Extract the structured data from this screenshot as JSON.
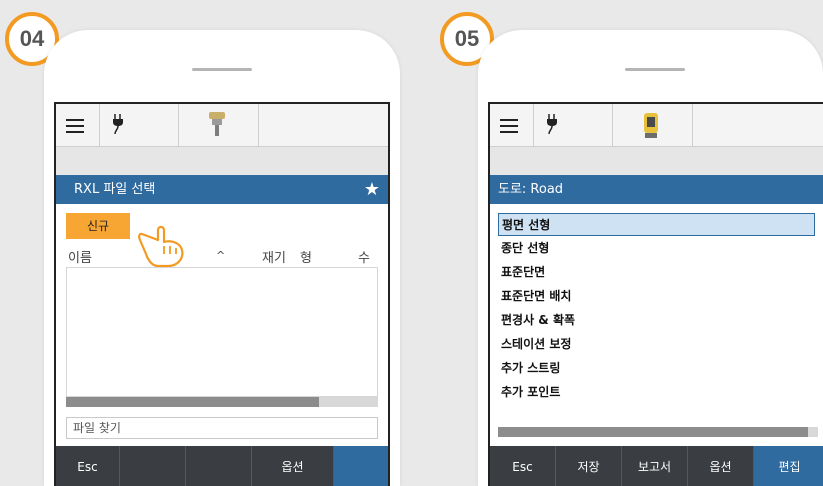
{
  "left_panel": {
    "step": "04",
    "header_title": "RXL 파일 선택",
    "star_icon": "star-icon",
    "new_button": "신규",
    "columns": [
      "이름",
      "^",
      "재기",
      "형",
      "수"
    ],
    "search_placeholder": "파일 찾기",
    "scroll_fraction": 0.81,
    "softkeys": [
      "Esc",
      "",
      "",
      "옵션",
      ""
    ]
  },
  "right_panel": {
    "step": "05",
    "header_title": "도로: Road",
    "items": [
      "평면 선형",
      "종단 선형",
      "표준단면",
      "표준단면 배치",
      "편경사 & 확폭",
      "스테이션 보정",
      "추가 스트링",
      "추가 포인트"
    ],
    "selected_index": 0,
    "scroll_fraction": 0.97,
    "softkeys": [
      "Esc",
      "저장",
      "보고서",
      "옵션",
      "편집"
    ]
  },
  "colors": {
    "badge_border": "#f29a21",
    "header_blue": "#2f6b9f",
    "new_button": "#f7a533",
    "softbar": "#3a3d42"
  }
}
